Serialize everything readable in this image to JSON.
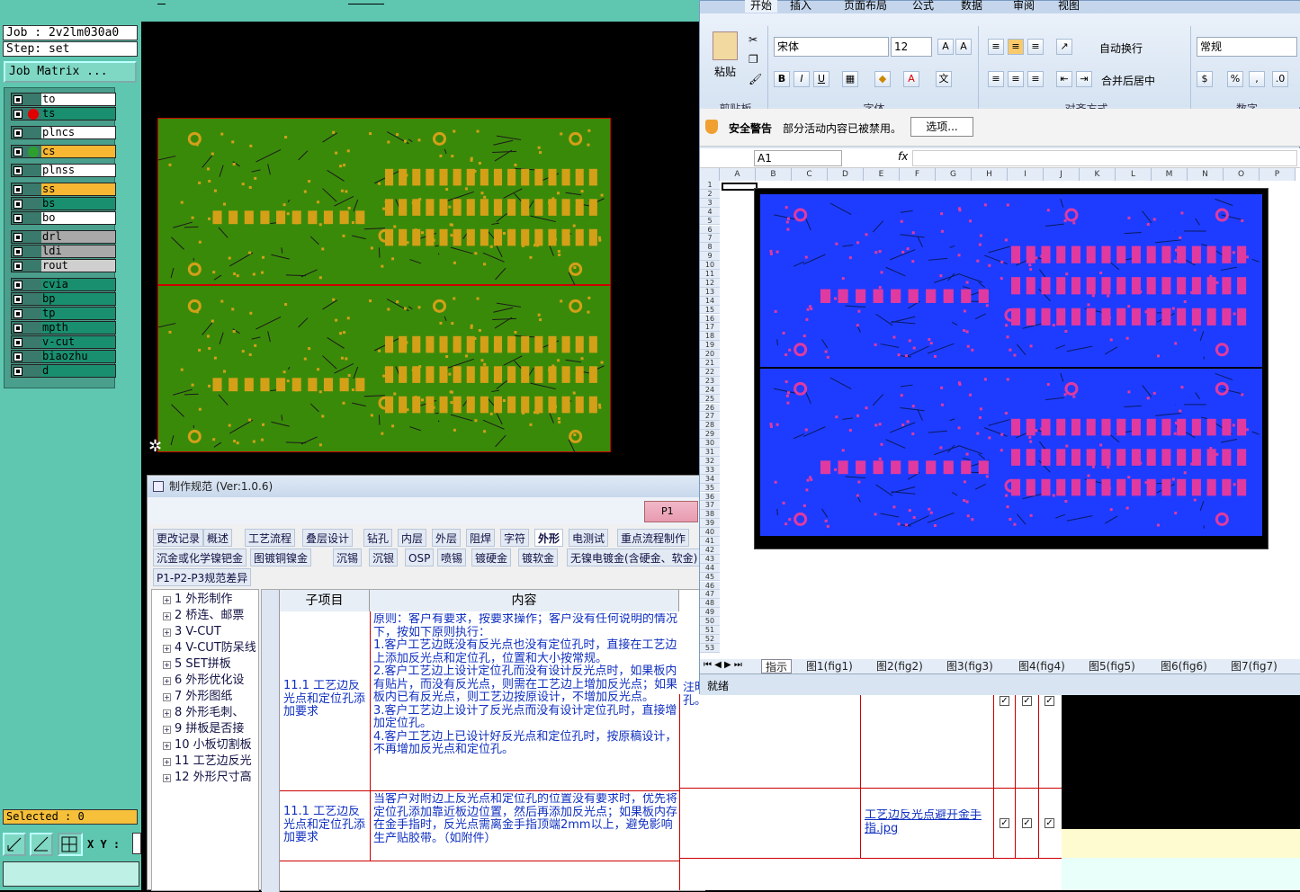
{
  "cam": {
    "job": "Job : 2v2lm030a0",
    "step": "Step: set",
    "matrix_button": "Job Matrix ...",
    "layers": [
      {
        "name": "to",
        "color": "#ffffff",
        "dot": ""
      },
      {
        "name": "ts",
        "color": "#1a8f70",
        "dot": "#e00000"
      },
      {
        "name": "plncs",
        "color": "#ffffff",
        "dot": ""
      },
      {
        "name": "cs",
        "color": "#f7b733",
        "dot": "#2e9e2e"
      },
      {
        "name": "plnss",
        "color": "#ffffff",
        "dot": ""
      },
      {
        "name": "ss",
        "color": "#f7b733",
        "dot": ""
      },
      {
        "name": "bs",
        "color": "#1a8f70",
        "dot": ""
      },
      {
        "name": "bo",
        "color": "#ffffff",
        "dot": ""
      },
      {
        "name": "drl",
        "color": "#a9a9a9",
        "dot": ""
      },
      {
        "name": "ldi",
        "color": "#a9a9a9",
        "dot": ""
      },
      {
        "name": "rout",
        "color": "#cfcfcf",
        "dot": ""
      },
      {
        "name": "cvia",
        "color": "#1a8f70",
        "dot": ""
      },
      {
        "name": "bp",
        "color": "#1a8f70",
        "dot": ""
      },
      {
        "name": "tp",
        "color": "#1a8f70",
        "dot": ""
      },
      {
        "name": "mpth",
        "color": "#1a8f70",
        "dot": ""
      },
      {
        "name": "v-cut",
        "color": "#1a8f70",
        "dot": ""
      },
      {
        "name": "biaozhu",
        "color": "#1a8f70",
        "dot": ""
      },
      {
        "name": "d",
        "color": "#1a8f70",
        "dot": ""
      }
    ],
    "selected": "Selected : 0",
    "xy_label": "X Y :"
  },
  "rules": {
    "title": "制作规范 (Ver:1.0.6)",
    "mini_tab": "P1",
    "tabs_row1": [
      "更改记录",
      "概述",
      "工艺流程",
      "叠层设计",
      "钻孔",
      "内层",
      "外层",
      "阻焊",
      "字符",
      "外形",
      "电测试",
      "重点流程制作"
    ],
    "tabs_row2": [
      "沉金或化学镍钯金",
      "图镀铜镍金",
      "沉锡",
      "沉银",
      "OSP",
      "喷锡",
      "镀硬金",
      "镀软金",
      "无镍电镀金(含硬金、软金)"
    ],
    "tabs_row3": [
      "P1-P2-P3规范差异"
    ],
    "active_tab": "外形",
    "tree": [
      "1 外形制作",
      "2 桥连、邮票",
      "3 V-CUT",
      "4 V-CUT防呆线",
      "5 SET拼板",
      "6 外形优化设",
      "7 外形图纸",
      "8 外形毛刺、",
      "9 拼板是否接",
      "10 小板切割板",
      "11 工艺边反光",
      "12 外形尺寸高"
    ],
    "col_sub": "子项目",
    "col_content": "内容",
    "row1_sub": "11.1 工艺边反光点和定位孔添加要求",
    "row1_content": "原则：客户有要求，按要求操作；客户没有任何说明的情况下，按如下原则执行：\n1.客户工艺边既没有反光点也没有定位孔时，直接在工艺边上添加反光点和定位孔，位置和大小按常规。\n2.客户工艺边上设计定位孔而没有设计反光点时，如果板内有贴片，而没有反光点，则需在工艺边上增加反光点；如果板内已有反光点，则工艺边按原设计，不增加反光点。\n3.客户工艺边上设计了反光点而没有设计定位孔时，直接增加定位孔。\n4.客户工艺边上已设计好反光点和定位孔时，按原稿设计，不再增加反光点和定位孔。",
    "row1_note": "注时，须确认加反光点、定位孔。",
    "row2_sub": "11.1 工艺边反光点和定位孔添加要求",
    "row2_content": "当客户对附边上反光点和定位孔的位置没有要求时，优先将定位孔添加靠近板边位置，然后再添加反光点；如果板内存在金手指时，反光点需离金手指顶端2mm以上，避免影响生产贴胶带。（如附件）",
    "row2_link": "工艺边反光点避开金手指.jpg"
  },
  "excel": {
    "ribbon_tabs": [
      "开始",
      "插入",
      "页面布局",
      "公式",
      "数据",
      "审阅",
      "视图"
    ],
    "paste": "粘贴",
    "clipboard": "剪贴板",
    "font_name": "宋体",
    "font_size": "12",
    "font_group": "字体",
    "wrap": "自动换行",
    "merge": "合并后居中",
    "align_group": "对齐方式",
    "number_format": "常规",
    "number_group": "数字",
    "security_title": "安全警告",
    "security_msg": "部分活动内容已被禁用。",
    "options_btn": "选项...",
    "name_box": "A1",
    "fx": "fx",
    "columns": [
      "A",
      "B",
      "C",
      "D",
      "E",
      "F",
      "G",
      "H",
      "I",
      "J",
      "K",
      "L",
      "M",
      "N",
      "O",
      "P"
    ],
    "sheet_tabs": [
      "指示",
      "图1(fig1)",
      "图2(fig2)",
      "图3(fig3)",
      "图4(fig4)",
      "图5(fig5)",
      "图6(fig6)",
      "图7(fig7)"
    ],
    "status": "就绪"
  }
}
